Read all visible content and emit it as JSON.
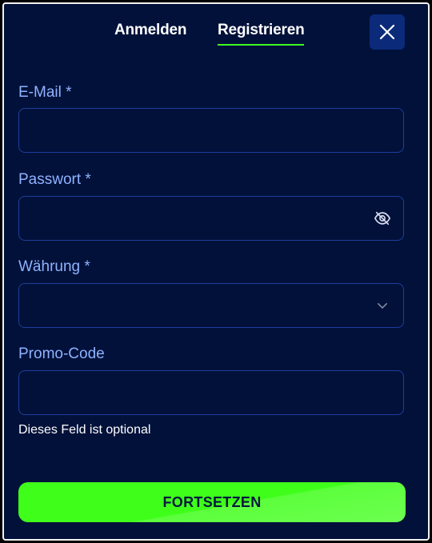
{
  "tabs": {
    "login": "Anmelden",
    "register": "Registrieren",
    "active": "register"
  },
  "fields": {
    "email": {
      "label": "E-Mail *",
      "value": "",
      "placeholder": ""
    },
    "password": {
      "label": "Passwort *",
      "value": "",
      "placeholder": "",
      "icon": "eye-off-icon"
    },
    "currency": {
      "label": "Währung *",
      "value": "",
      "icon": "chevron-down-icon"
    },
    "promo": {
      "label": "Promo-Code",
      "value": "",
      "placeholder": "",
      "hint": "Dieses Feld ist optional"
    }
  },
  "submit_label": "FORTSETZEN",
  "colors": {
    "background": "#02113a",
    "accent": "#3cff1f",
    "label": "#8fb2ff",
    "field_border": "#1e3e9a",
    "close_button": "#0b2a7a"
  }
}
